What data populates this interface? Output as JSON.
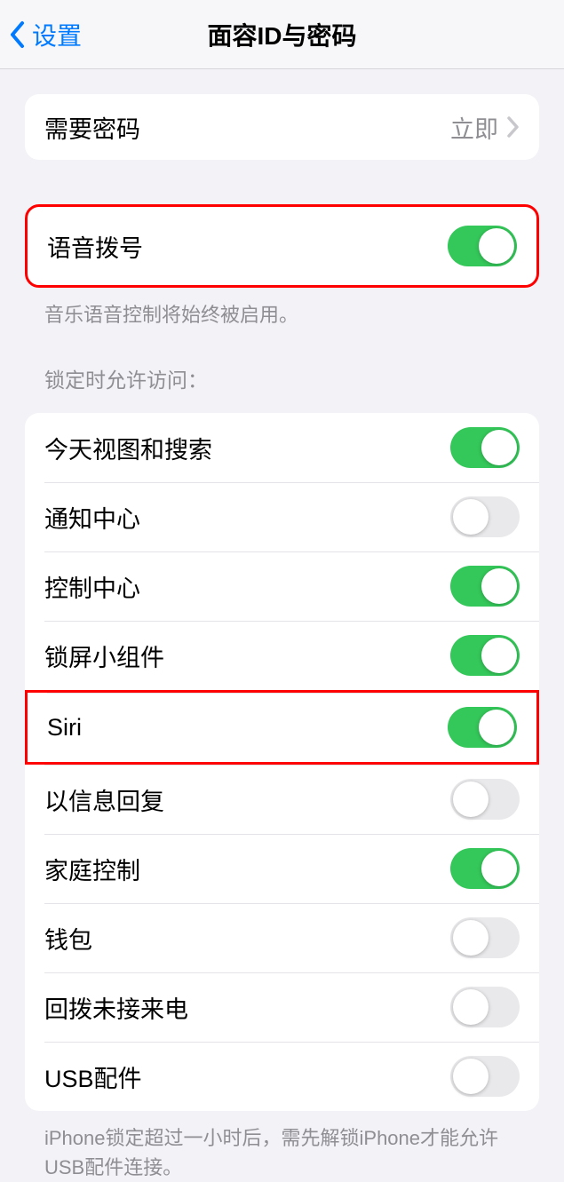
{
  "nav": {
    "back_label": "设置",
    "title": "面容ID与密码"
  },
  "require_passcode": {
    "label": "需要密码",
    "value": "立即"
  },
  "voice_dial": {
    "label": "语音拨号",
    "on": true,
    "footer": "音乐语音控制将始终被启用。"
  },
  "lock_section": {
    "header": "锁定时允许访问：",
    "items": [
      {
        "label": "今天视图和搜索",
        "on": true
      },
      {
        "label": "通知中心",
        "on": false
      },
      {
        "label": "控制中心",
        "on": true
      },
      {
        "label": "锁屏小组件",
        "on": true
      },
      {
        "label": "Siri",
        "on": true,
        "highlighted": true
      },
      {
        "label": "以信息回复",
        "on": false
      },
      {
        "label": "家庭控制",
        "on": true
      },
      {
        "label": "钱包",
        "on": false
      },
      {
        "label": "回拨未接来电",
        "on": false
      },
      {
        "label": "USB配件",
        "on": false
      }
    ],
    "footer": "iPhone锁定超过一小时后，需先解锁iPhone才能允许USB配件连接。"
  }
}
